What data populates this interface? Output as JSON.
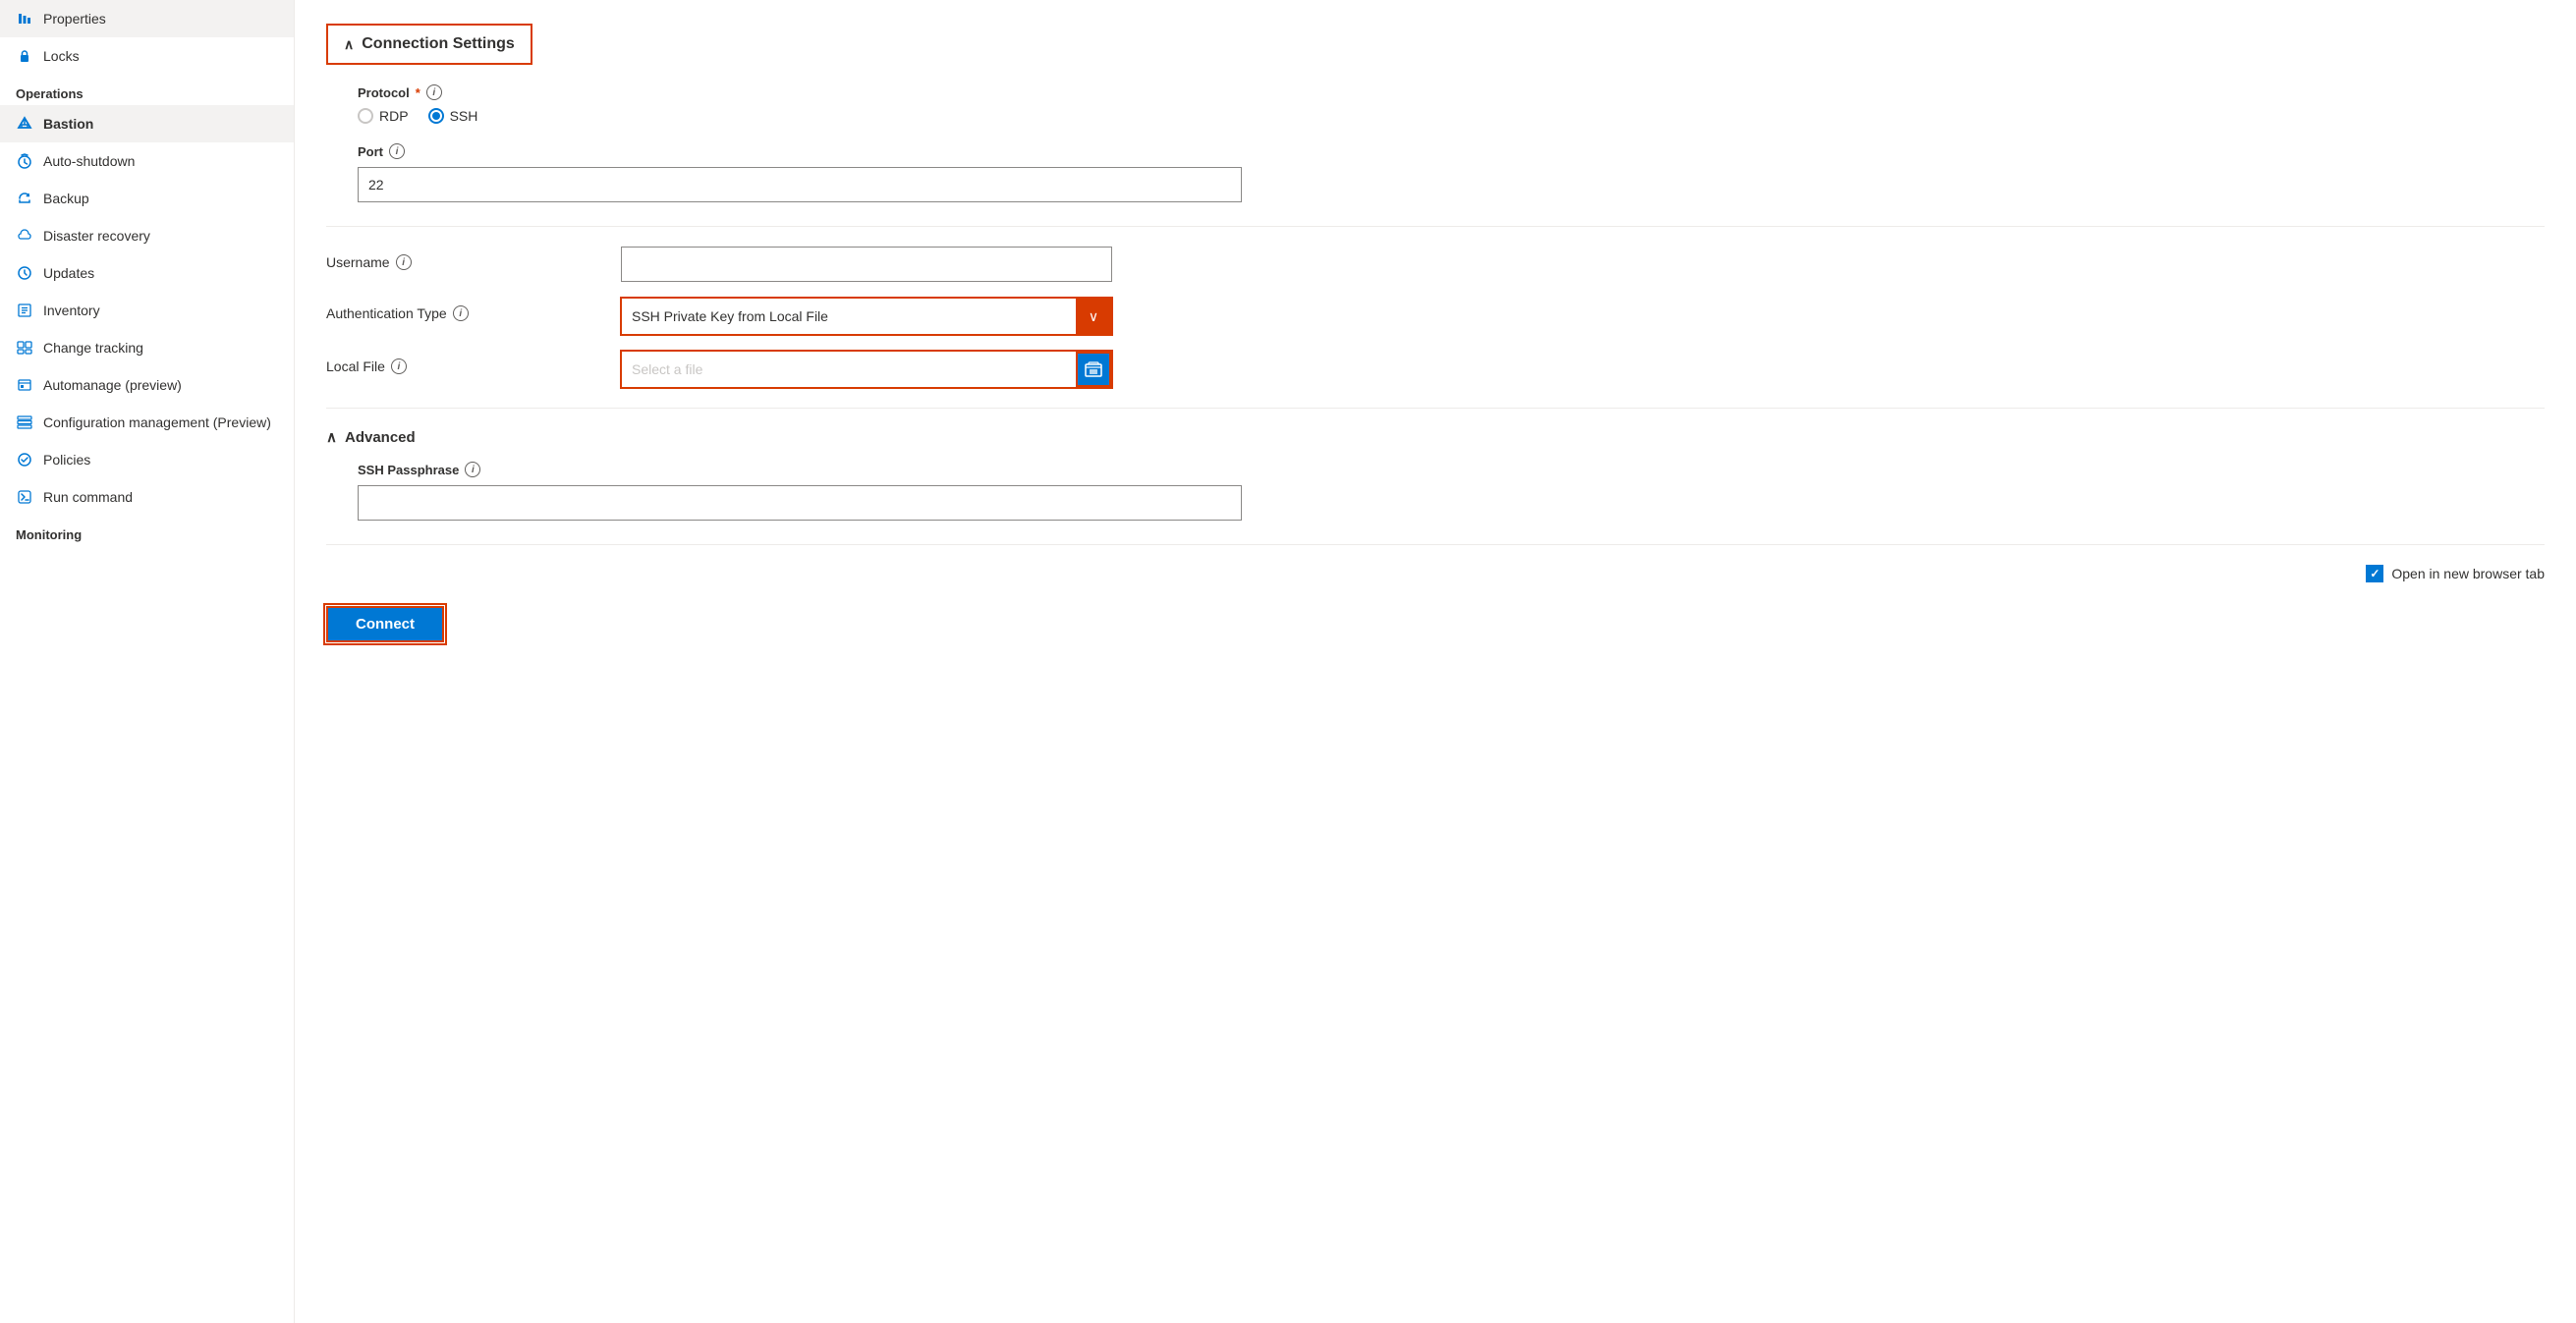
{
  "sidebar": {
    "items": [
      {
        "id": "properties",
        "label": "Properties",
        "icon": "bars-icon",
        "active": false,
        "section": null
      },
      {
        "id": "locks",
        "label": "Locks",
        "icon": "lock-icon",
        "active": false,
        "section": null
      },
      {
        "id": "operations-section",
        "label": "Operations",
        "isSection": true
      },
      {
        "id": "bastion",
        "label": "Bastion",
        "icon": "bastion-icon",
        "active": true,
        "section": "Operations"
      },
      {
        "id": "auto-shutdown",
        "label": "Auto-shutdown",
        "icon": "clock-icon",
        "active": false,
        "section": "Operations"
      },
      {
        "id": "backup",
        "label": "Backup",
        "icon": "backup-icon",
        "active": false,
        "section": "Operations"
      },
      {
        "id": "disaster-recovery",
        "label": "Disaster recovery",
        "icon": "disaster-icon",
        "active": false,
        "section": "Operations"
      },
      {
        "id": "updates",
        "label": "Updates",
        "icon": "updates-icon",
        "active": false,
        "section": "Operations"
      },
      {
        "id": "inventory",
        "label": "Inventory",
        "icon": "inventory-icon",
        "active": false,
        "section": "Operations"
      },
      {
        "id": "change-tracking",
        "label": "Change tracking",
        "icon": "change-icon",
        "active": false,
        "section": "Operations"
      },
      {
        "id": "automanage",
        "label": "Automanage (preview)",
        "icon": "automanage-icon",
        "active": false,
        "section": "Operations"
      },
      {
        "id": "config-management",
        "label": "Configuration management (Preview)",
        "icon": "config-icon",
        "active": false,
        "section": "Operations"
      },
      {
        "id": "policies",
        "label": "Policies",
        "icon": "policies-icon",
        "active": false,
        "section": "Operations"
      },
      {
        "id": "run-command",
        "label": "Run command",
        "icon": "run-icon",
        "active": false,
        "section": "Operations"
      },
      {
        "id": "monitoring-section",
        "label": "Monitoring",
        "isSection": true
      }
    ]
  },
  "main": {
    "connection_settings_title": "Connection Settings",
    "protocol_label": "Protocol",
    "protocol_options": [
      {
        "id": "rdp",
        "label": "RDP",
        "selected": false
      },
      {
        "id": "ssh",
        "label": "SSH",
        "selected": true
      }
    ],
    "port_label": "Port",
    "port_value": "22",
    "divider_line": true,
    "username_label": "Username",
    "username_placeholder": "",
    "auth_type_label": "Authentication Type",
    "auth_type_value": "SSH Private Key from Local File",
    "local_file_label": "Local File",
    "local_file_placeholder": "Select a file",
    "advanced_title": "Advanced",
    "ssh_passphrase_label": "SSH Passphrase",
    "ssh_passphrase_value": "",
    "open_new_tab_label": "Open in new browser tab",
    "open_new_tab_checked": true,
    "connect_button_label": "Connect"
  },
  "icons": {
    "chevron_up": "∧",
    "chevron_down": "∨",
    "info": "i",
    "check": "✓",
    "folder": "📁"
  }
}
